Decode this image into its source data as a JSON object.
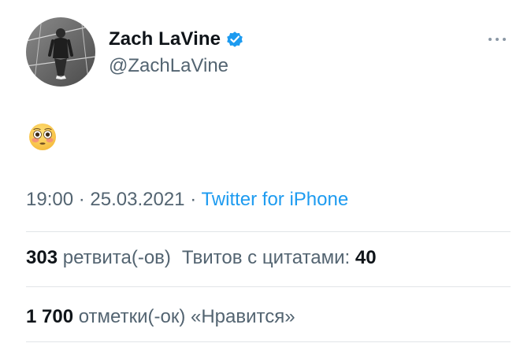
{
  "user": {
    "display_name": "Zach LaVine",
    "handle": "@ZachLaVine",
    "verified": true
  },
  "tweet": {
    "content_emoji": "flushed-face",
    "time": "19:00",
    "separator": "·",
    "date": "25.03.2021",
    "source": "Twitter for iPhone"
  },
  "stats": {
    "retweets_count": "303",
    "retweets_label": "ретвита(-ов)",
    "quotes_label": "Твитов с цитатами:",
    "quotes_count": "40",
    "likes_count": "1 700",
    "likes_label": "отметки(-ок) «Нравится»"
  },
  "colors": {
    "verified_badge": "#1d9bf0",
    "link": "#1d9bf0",
    "secondary_text": "#536471",
    "primary_text": "#0f1419",
    "divider": "#e1e5e8"
  }
}
